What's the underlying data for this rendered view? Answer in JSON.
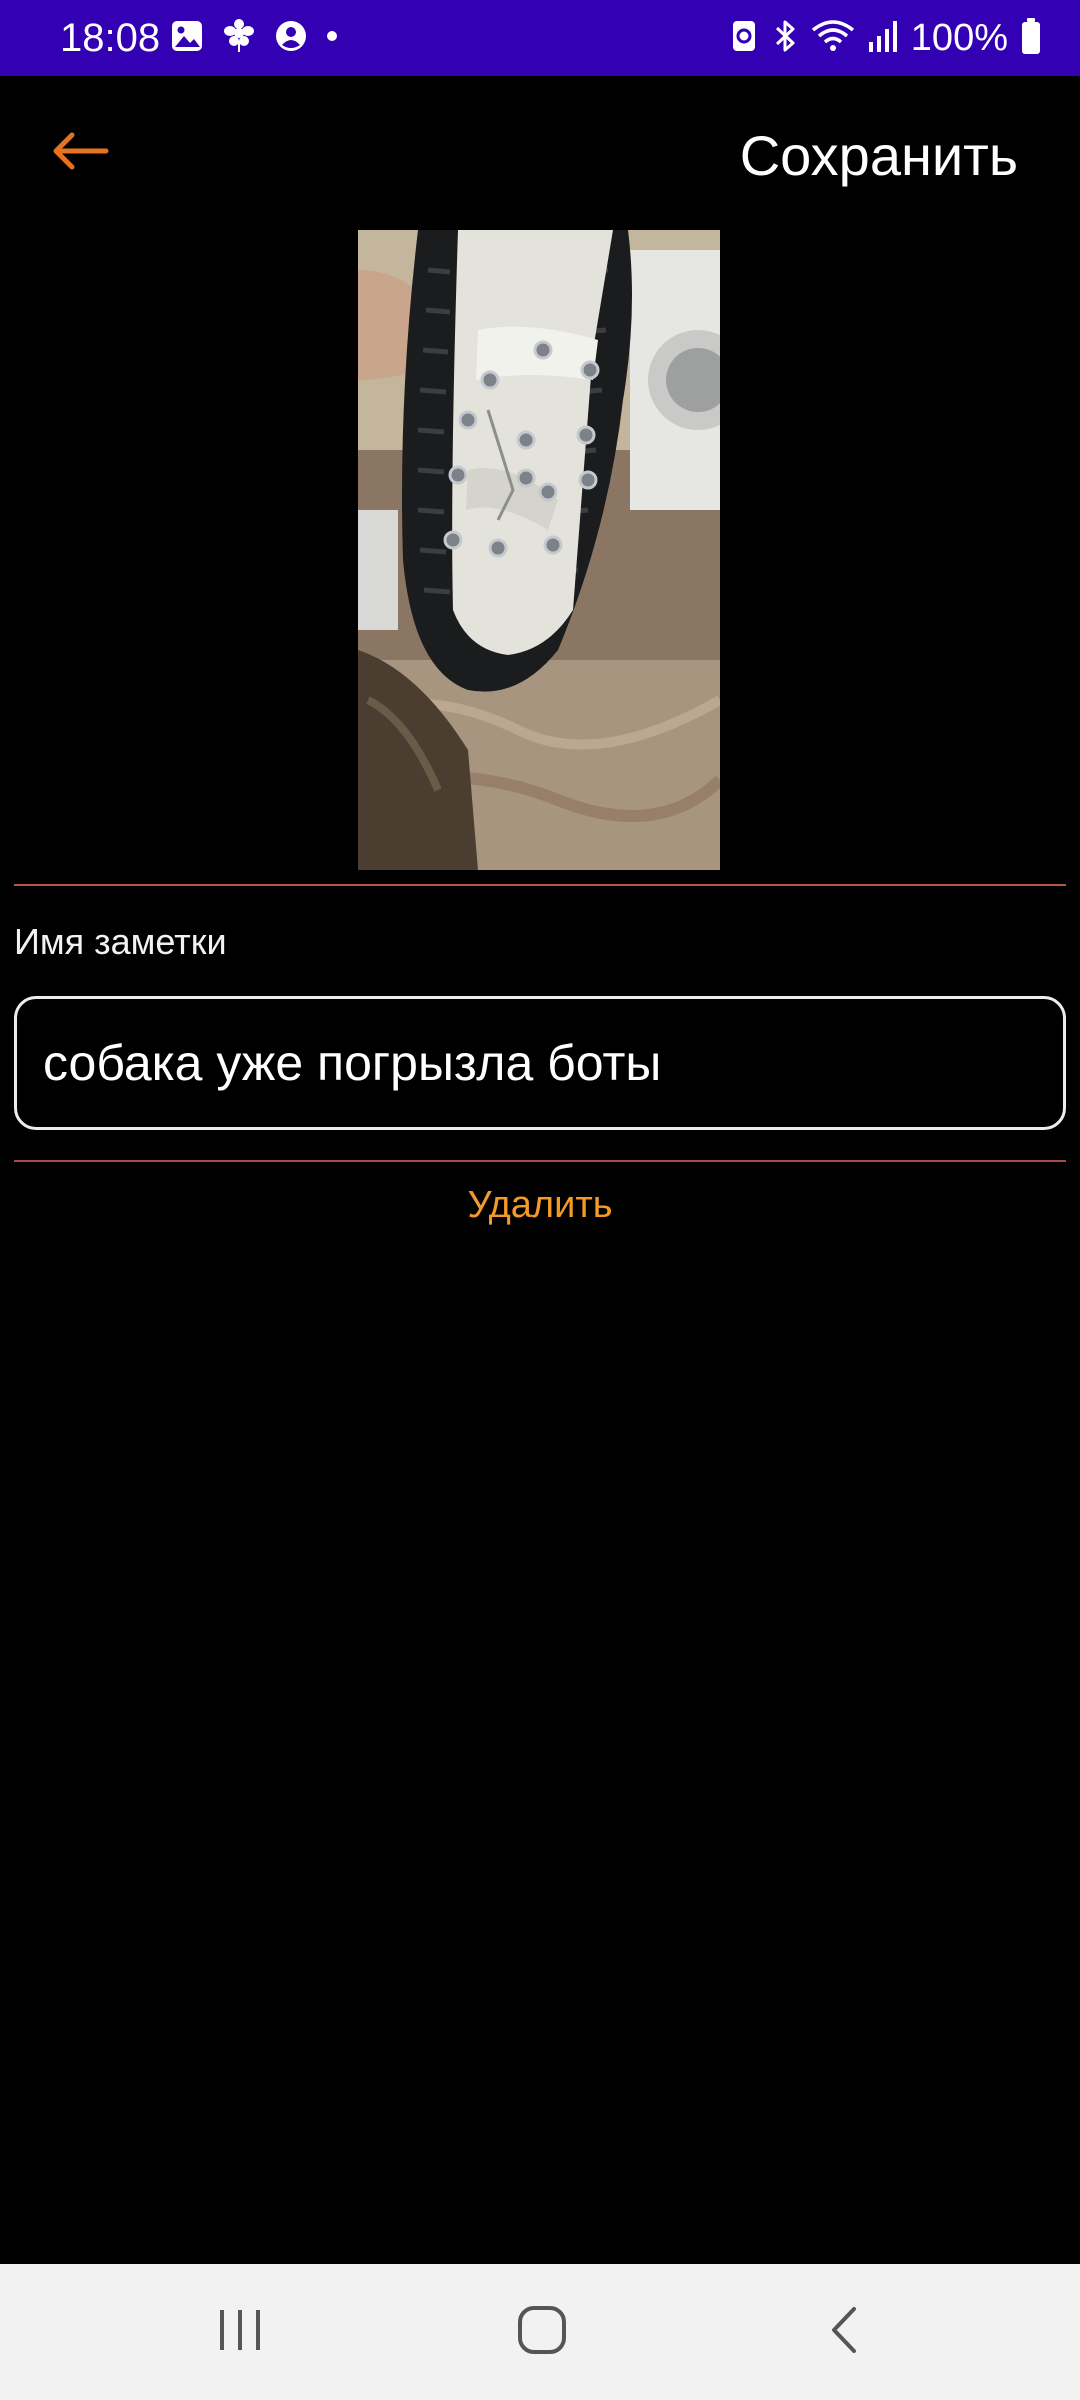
{
  "status_bar": {
    "time": "18:08",
    "battery": "100%",
    "background": "#3300b3",
    "left_icons": [
      "gallery-icon",
      "pinwheel-icon",
      "account-circle-icon",
      "dot-icon"
    ],
    "right_icons": [
      "data-saver-icon",
      "bluetooth-icon",
      "wifi-icon",
      "signal-icon",
      "battery-icon"
    ]
  },
  "app_bar": {
    "back_icon": "arrow-left-icon",
    "back_color": "#e8731e",
    "save_label": "Сохранить"
  },
  "photo": {
    "subject": "boot-sole-photo"
  },
  "form": {
    "name_label": "Имя заметки",
    "name_value": "собака уже погрызла боты"
  },
  "actions": {
    "delete_label": "Удалить",
    "delete_color": "#f39a2a"
  },
  "nav_bar": {
    "icons": [
      "recents-icon",
      "home-icon",
      "back-icon"
    ]
  }
}
